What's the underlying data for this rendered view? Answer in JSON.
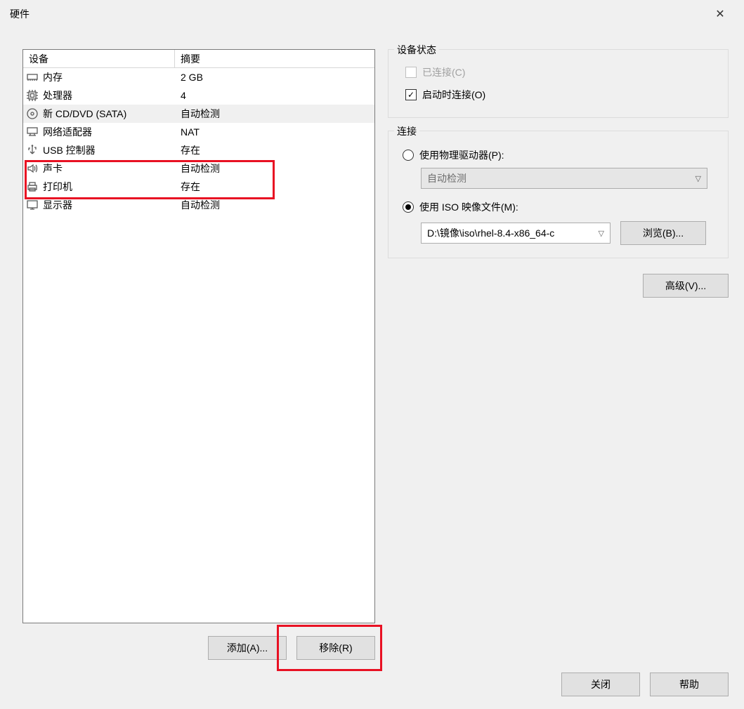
{
  "title": "硬件",
  "device_table": {
    "col1": "设备",
    "col2": "摘要",
    "rows": [
      {
        "icon": "memory",
        "name": "内存",
        "summary": "2 GB",
        "sel": false
      },
      {
        "icon": "cpu",
        "name": "处理器",
        "summary": "4",
        "sel": false
      },
      {
        "icon": "disc",
        "name": "新 CD/DVD (SATA)",
        "summary": "自动检测",
        "sel": true
      },
      {
        "icon": "net",
        "name": "网络适配器",
        "summary": "NAT",
        "sel": false
      },
      {
        "icon": "usb",
        "name": "USB 控制器",
        "summary": "存在",
        "sel": false
      },
      {
        "icon": "sound",
        "name": "声卡",
        "summary": "自动检测",
        "sel": false
      },
      {
        "icon": "printer",
        "name": "打印机",
        "summary": "存在",
        "sel": false
      },
      {
        "icon": "display",
        "name": "显示器",
        "summary": "自动检测",
        "sel": false
      }
    ]
  },
  "buttons": {
    "add": "添加(A)...",
    "remove": "移除(R)",
    "browse": "浏览(B)...",
    "advanced": "高级(V)...",
    "close": "关闭",
    "help": "帮助"
  },
  "status_group": {
    "title": "设备状态",
    "connected": "已连接(C)",
    "connect_on_start": "启动时连接(O)"
  },
  "connect_group": {
    "title": "连接",
    "use_physical": "使用物理驱动器(P):",
    "physical_value": "自动检测",
    "use_iso": "使用 ISO 映像文件(M):",
    "iso_path": "D:\\镜像\\iso\\rhel-8.4-x86_64-c"
  }
}
